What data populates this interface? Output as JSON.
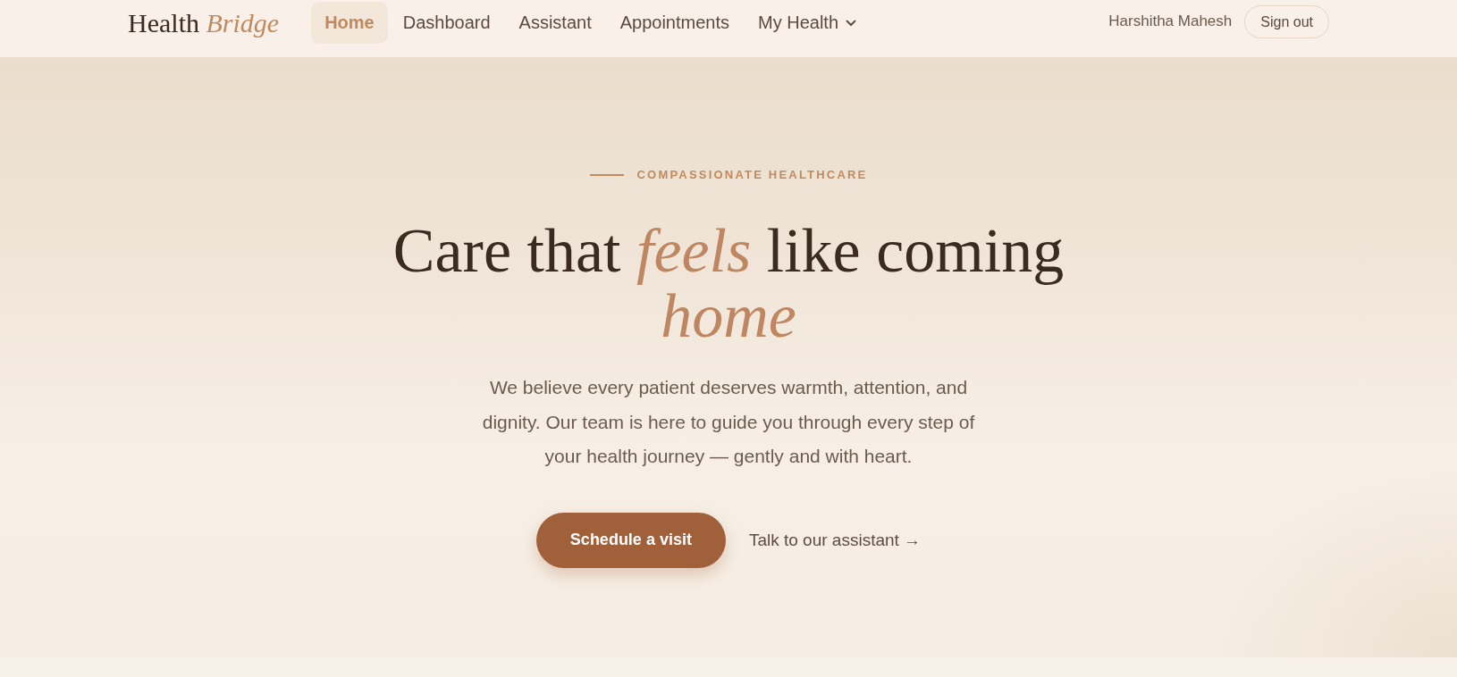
{
  "nav": {
    "logo": "Health *Bridge*",
    "items": [
      {
        "label": "Home",
        "selected": true,
        "kind": "link"
      },
      {
        "label": "Dashboard",
        "selected": false,
        "kind": "link"
      },
      {
        "label": "Assistant",
        "selected": false,
        "kind": "link"
      },
      {
        "label": "Appointments",
        "selected": false,
        "kind": "link"
      },
      {
        "label": "My Health",
        "selected": false,
        "kind": "dropdown"
      }
    ],
    "user_name": "Harshitha Mahesh",
    "sign_out": "Sign out"
  },
  "hero": {
    "eyebrow": "COMPASSIONATE HEALTHCARE",
    "title": "Care that *feels* like coming *home*",
    "text": "We believe every patient deserves warmth, attention, and dignity. Our team is here to guide you through every step of your health journey — gently and with heart.",
    "primary_button": "Schedule a visit",
    "secondary_link": "Talk to our assistant →"
  }
}
